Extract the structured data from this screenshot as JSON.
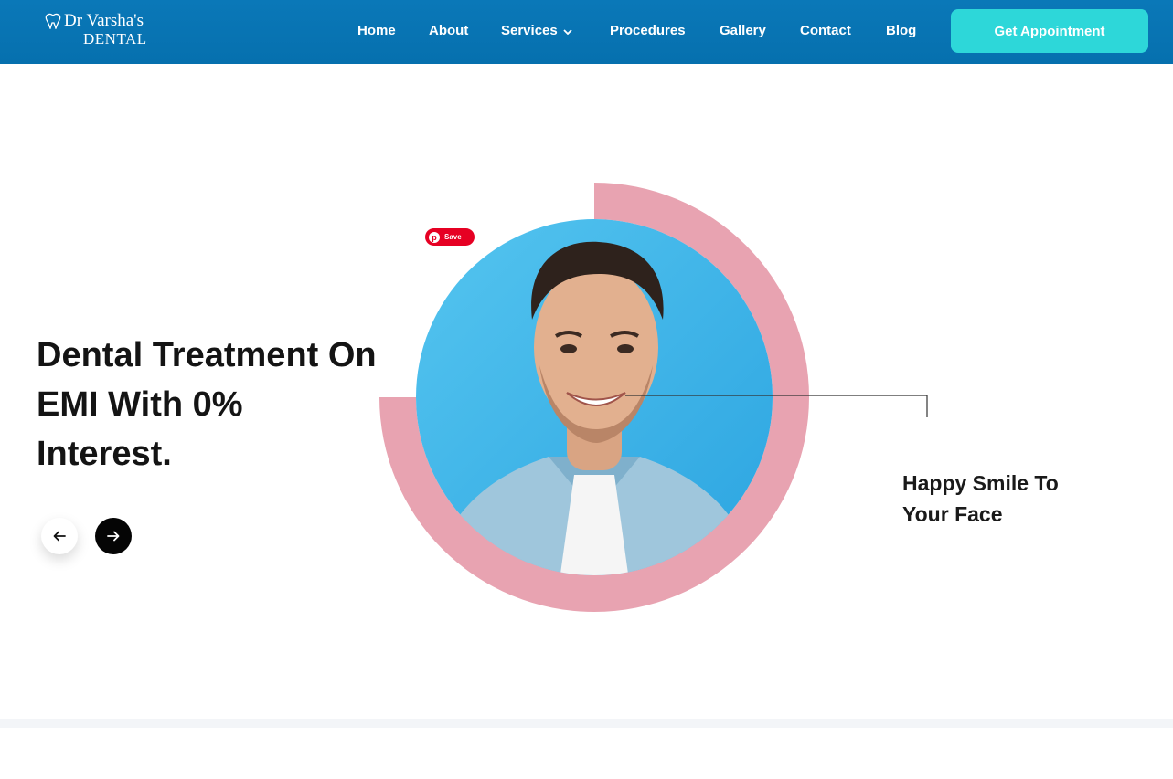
{
  "header": {
    "logo": {
      "line1": "Dr Varsha's",
      "line2": "DENTAL"
    },
    "nav": [
      {
        "label": "Home",
        "has_dropdown": false
      },
      {
        "label": "About",
        "has_dropdown": false
      },
      {
        "label": "Services",
        "has_dropdown": true
      },
      {
        "label": "Procedures",
        "has_dropdown": false
      },
      {
        "label": "Gallery",
        "has_dropdown": false
      },
      {
        "label": "Contact",
        "has_dropdown": false
      },
      {
        "label": "Blog",
        "has_dropdown": false
      }
    ],
    "cta_label": "Get Appointment"
  },
  "hero": {
    "headline": "Dental Treatment On EMI With 0% Interest.",
    "prev_icon": "arrow-left-icon",
    "next_icon": "arrow-right-icon",
    "pinterest_save_label": "Save",
    "caption": "Happy Smile To Your Face"
  },
  "colors": {
    "header_bg": "#0670ae",
    "cta_bg": "#2dd7d9",
    "ring_pink": "#e8a3b1",
    "photo_bg": "#3fb3e8",
    "pinterest_red": "#e60023",
    "text_dark": "#141414"
  }
}
